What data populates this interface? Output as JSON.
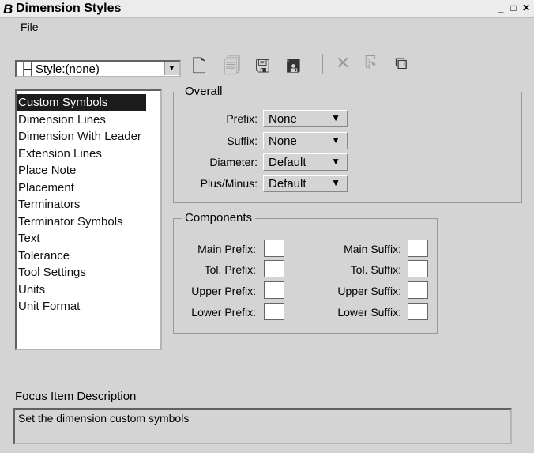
{
  "window": {
    "title": "Dimension Styles",
    "title_icon": "bentley-b-icon"
  },
  "menu": {
    "file_label": "File"
  },
  "style_selector": {
    "value": "Style:(none)"
  },
  "toolbar": {
    "icons": [
      "new-style-icon",
      "open-style-icon",
      "save-icon",
      "save-as-icon",
      "delete-icon",
      "reset-icon",
      "compare-icon"
    ]
  },
  "categories": {
    "items": [
      "Custom Symbols",
      "Dimension Lines",
      "Dimension With Leader",
      "Extension Lines",
      "Place Note",
      "Placement",
      "Terminators",
      "Terminator Symbols",
      "Text",
      "Tolerance",
      "Tool Settings",
      "Units",
      "Unit Format"
    ],
    "selected": "Custom Symbols"
  },
  "overall": {
    "title": "Overall",
    "prefix_label": "Prefix:",
    "prefix_value": "None",
    "suffix_label": "Suffix:",
    "suffix_value": "None",
    "diameter_label": "Diameter:",
    "diameter_value": "Default",
    "plusminus_label": "Plus/Minus:",
    "plusminus_value": "Default"
  },
  "components": {
    "title": "Components",
    "main_prefix": "Main Prefix:",
    "tol_prefix": "Tol. Prefix:",
    "upper_prefix": "Upper Prefix:",
    "lower_prefix": "Lower Prefix:",
    "main_suffix": "Main Suffix:",
    "tol_suffix": "Tol. Suffix:",
    "upper_suffix": "Upper Suffix:",
    "lower_suffix": "Lower Suffix:"
  },
  "focus": {
    "label": "Focus Item Description",
    "description": "Set the dimension custom symbols"
  }
}
